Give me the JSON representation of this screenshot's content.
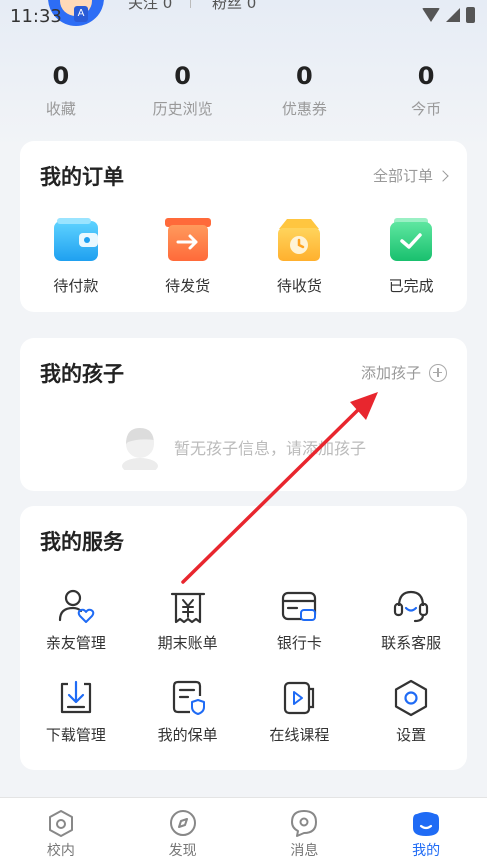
{
  "status": {
    "time": "11:33",
    "follow": "关注 0",
    "fans": "粉丝 0"
  },
  "stats": [
    {
      "value": "0",
      "label": "收藏"
    },
    {
      "value": "0",
      "label": "历史浏览"
    },
    {
      "value": "0",
      "label": "优惠券"
    },
    {
      "value": "0",
      "label": "今币"
    }
  ],
  "orders": {
    "title": "我的订单",
    "all_link": "全部订单",
    "items": [
      {
        "label": "待付款",
        "icon": "wallet-icon"
      },
      {
        "label": "待发货",
        "icon": "ship-box-icon"
      },
      {
        "label": "待收货",
        "icon": "receive-box-icon"
      },
      {
        "label": "已完成",
        "icon": "completed-icon"
      }
    ]
  },
  "children": {
    "title": "我的孩子",
    "add_link": "添加孩子",
    "empty_text": "暂无孩子信息，请添加孩子"
  },
  "services": {
    "title": "我的服务",
    "items": [
      {
        "label": "亲友管理",
        "icon": "family-icon"
      },
      {
        "label": "期末账单",
        "icon": "bill-icon"
      },
      {
        "label": "银行卡",
        "icon": "bank-card-icon"
      },
      {
        "label": "联系客服",
        "icon": "customer-service-icon"
      },
      {
        "label": "下载管理",
        "icon": "download-icon"
      },
      {
        "label": "我的保单",
        "icon": "policy-icon"
      },
      {
        "label": "在线课程",
        "icon": "online-course-icon"
      },
      {
        "label": "设置",
        "icon": "settings-icon"
      }
    ]
  },
  "tabs": [
    {
      "label": "校内",
      "icon": "campus-icon",
      "active": false
    },
    {
      "label": "发现",
      "icon": "discover-icon",
      "active": false
    },
    {
      "label": "消息",
      "icon": "message-icon",
      "active": false
    },
    {
      "label": "我的",
      "icon": "mine-icon",
      "active": true
    }
  ],
  "colors": {
    "accent": "#1f6bf5",
    "arrow": "#e8262e"
  }
}
